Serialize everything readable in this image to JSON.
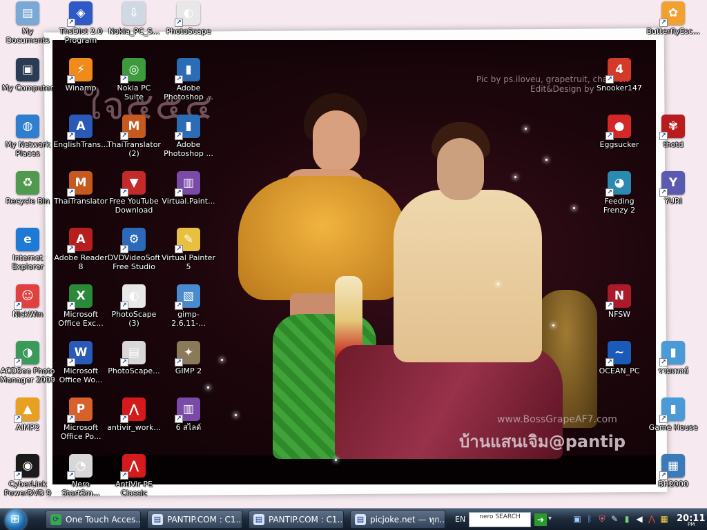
{
  "wallpaper": {
    "thai_title": "ใจ๕๕๔",
    "credit_line1": "Pic by  ps.iloveu, grapetruit, channel7",
    "credit_line2": "Edit&Design by",
    "watermark_url": "www.BossGrapeAF7.com",
    "watermark_text": "บ้านแสนเจิม@pantip"
  },
  "icons": [
    {
      "id": "my-documents",
      "label": "My Documents",
      "color": "#7aa9d6",
      "glyph": "▤",
      "shortcut": false
    },
    {
      "id": "thsdict",
      "label": "ThsDict 2.0 Program",
      "color": "#2e5ac8",
      "glyph": "◈",
      "shortcut": true
    },
    {
      "id": "nokia-pc-s",
      "label": "Nokia_PC_S...",
      "color": "#cfd8e3",
      "glyph": "⇩",
      "shortcut": false
    },
    {
      "id": "photoscape-top",
      "label": "PhotoScape",
      "color": "#e8e8e8",
      "glyph": "◐",
      "shortcut": true
    },
    {
      "id": "butterfly",
      "label": "ButterflyEsc...",
      "color": "#f2a030",
      "glyph": "✿",
      "shortcut": true
    },
    {
      "id": "my-computer",
      "label": "My Computer",
      "color": "#2a3c55",
      "glyph": "▣",
      "shortcut": false
    },
    {
      "id": "winamp",
      "label": "Winamp",
      "color": "#f08a1a",
      "glyph": "⚡",
      "shortcut": true
    },
    {
      "id": "nokia-pc-suite",
      "label": "Nokia PC Suite",
      "color": "#3d9a3d",
      "glyph": "◎",
      "shortcut": true
    },
    {
      "id": "adobe-ps-1",
      "label": "Adobe Photoshop ...",
      "color": "#2b6cb5",
      "glyph": "▮",
      "shortcut": true
    },
    {
      "id": "snooker147",
      "label": "Snooker147",
      "color": "#d43a2a",
      "glyph": "4",
      "shortcut": true
    },
    {
      "id": "my-network",
      "label": "My Network Places",
      "color": "#2f7ed0",
      "glyph": "◍",
      "shortcut": false
    },
    {
      "id": "englishtrans",
      "label": "EnglishTrans...",
      "color": "#2a5ab8",
      "glyph": "A",
      "shortcut": true
    },
    {
      "id": "thaitranslator2",
      "label": "ThaiTranslator (2)",
      "color": "#c65a1e",
      "glyph": "M",
      "shortcut": true
    },
    {
      "id": "adobe-ps-2",
      "label": "Adobe Photoshop ...",
      "color": "#2b6cb5",
      "glyph": "▮",
      "shortcut": true
    },
    {
      "id": "eggsucker",
      "label": "Eggsucker",
      "color": "#d42828",
      "glyph": "●",
      "shortcut": true
    },
    {
      "id": "thotd",
      "label": "thotd",
      "color": "#b81c1c",
      "glyph": "✾",
      "shortcut": true
    },
    {
      "id": "recycle-bin",
      "label": "Recycle Bin",
      "color": "#4f9a4f",
      "glyph": "♻",
      "shortcut": false
    },
    {
      "id": "thaitranslator",
      "label": "ThaiTranslator",
      "color": "#c65a1e",
      "glyph": "M",
      "shortcut": true
    },
    {
      "id": "free-youtube",
      "label": "Free YouTube Download",
      "color": "#c42a2a",
      "glyph": "▼",
      "shortcut": true
    },
    {
      "id": "virtual-paint",
      "label": "Virtual.Paint...",
      "color": "#7a4aa8",
      "glyph": "▥",
      "shortcut": true
    },
    {
      "id": "feeding-frenzy",
      "label": "Feeding Frenzy 2",
      "color": "#2a8ab0",
      "glyph": "◕",
      "shortcut": true
    },
    {
      "id": "yuri",
      "label": "YURI",
      "color": "#5a5ab0",
      "glyph": "Y",
      "shortcut": true
    },
    {
      "id": "internet-explorer",
      "label": "Internet Explorer",
      "color": "#1d7ad6",
      "glyph": "e",
      "shortcut": false
    },
    {
      "id": "adobe-reader",
      "label": "Adobe Reader 8",
      "color": "#b81e1e",
      "glyph": "A",
      "shortcut": true
    },
    {
      "id": "dvdvideosoft",
      "label": "DVDVideoSoft Free Studio",
      "color": "#2a6ab8",
      "glyph": "⚙",
      "shortcut": true
    },
    {
      "id": "virtual-painter",
      "label": "Virtual Painter 5",
      "color": "#e8c040",
      "glyph": "✎",
      "shortcut": true
    },
    {
      "id": "nickwin",
      "label": "NickWin",
      "color": "#e04040",
      "glyph": "☺",
      "shortcut": true
    },
    {
      "id": "ms-excel",
      "label": "Microsoft Office Exc...",
      "color": "#2a8a3a",
      "glyph": "X",
      "shortcut": true
    },
    {
      "id": "photoscape-3",
      "label": "PhotoScape (3)",
      "color": "#e8e8e8",
      "glyph": "◐",
      "shortcut": true
    },
    {
      "id": "gimp-2611",
      "label": "gimp-2.6.11-...",
      "color": "#4a8ad0",
      "glyph": "▧",
      "shortcut": true
    },
    {
      "id": "nfsw",
      "label": "NFSW",
      "color": "#aa1a2a",
      "glyph": "N",
      "shortcut": true
    },
    {
      "id": "acdsee",
      "label": "ACDSee Photo Manager 2009",
      "color": "#3a9a5a",
      "glyph": "◑",
      "shortcut": true
    },
    {
      "id": "ms-word",
      "label": "Microsoft Office Wo...",
      "color": "#2a5ab8",
      "glyph": "W",
      "shortcut": true
    },
    {
      "id": "photoscape-dots",
      "label": "PhotoScape...",
      "color": "#d8d8d8",
      "glyph": "▤",
      "shortcut": true
    },
    {
      "id": "gimp-2",
      "label": "GIMP 2",
      "color": "#8a7a5a",
      "glyph": "✦",
      "shortcut": true
    },
    {
      "id": "ocean-pc",
      "label": "OCEAN_PC",
      "color": "#1a5ab8",
      "glyph": "~",
      "shortcut": true
    },
    {
      "id": "thai-doc",
      "label": "รวมเพลย์",
      "color": "#4a9ad8",
      "glyph": "▮",
      "shortcut": true
    },
    {
      "id": "aimp2",
      "label": "AIMP2",
      "color": "#e8a020",
      "glyph": "▲",
      "shortcut": true
    },
    {
      "id": "ms-powerpoint",
      "label": "Microsoft Office Po...",
      "color": "#d8602a",
      "glyph": "P",
      "shortcut": true
    },
    {
      "id": "antivir-work",
      "label": "antivir_work...",
      "color": "#d41a1a",
      "glyph": "⋀",
      "shortcut": true
    },
    {
      "id": "six-files",
      "label": "6 สไลด์",
      "color": "#7a4aa8",
      "glyph": "▥",
      "shortcut": true
    },
    {
      "id": "game-house",
      "label": "Game House",
      "color": "#4a9ad8",
      "glyph": "▮",
      "shortcut": true
    },
    {
      "id": "cyberlink",
      "label": "CyberLink PowerDVD 9",
      "color": "#1a1a1a",
      "glyph": "◉",
      "shortcut": true
    },
    {
      "id": "nero-start",
      "label": "Nero StartSm...",
      "color": "#d8d8d8",
      "glyph": "◔",
      "shortcut": true
    },
    {
      "id": "antivir-pe",
      "label": "AntiVir PE Classic",
      "color": "#d41a1a",
      "glyph": "⋀",
      "shortcut": true
    },
    {
      "id": "bh2000",
      "label": "BH2000",
      "color": "#3a7ab8",
      "glyph": "▦",
      "shortcut": true
    }
  ],
  "taskbar": {
    "tasks": [
      {
        "label": "One Touch Acces...",
        "color": "#3aa84a",
        "glyph": "⟳"
      },
      {
        "label": "PANTIP.COM : C1...",
        "color": "#d8e4f4",
        "glyph": "▤"
      },
      {
        "label": "PANTIP.COM : C1...",
        "color": "#d8e4f4",
        "glyph": "▤"
      },
      {
        "label": "picjoke.net — ทุก...",
        "color": "#d8e4f4",
        "glyph": "▤"
      }
    ],
    "language": "EN",
    "nero_search_label": "nero SEARCH",
    "clock_time": "20:11",
    "clock_ampm": "PM",
    "tray_icons": [
      "network-icon",
      "bluetooth-icon",
      "shield-icon",
      "pen-icon",
      "battery-icon",
      "volume-icon",
      "antivir-icon",
      "app-icon"
    ]
  }
}
